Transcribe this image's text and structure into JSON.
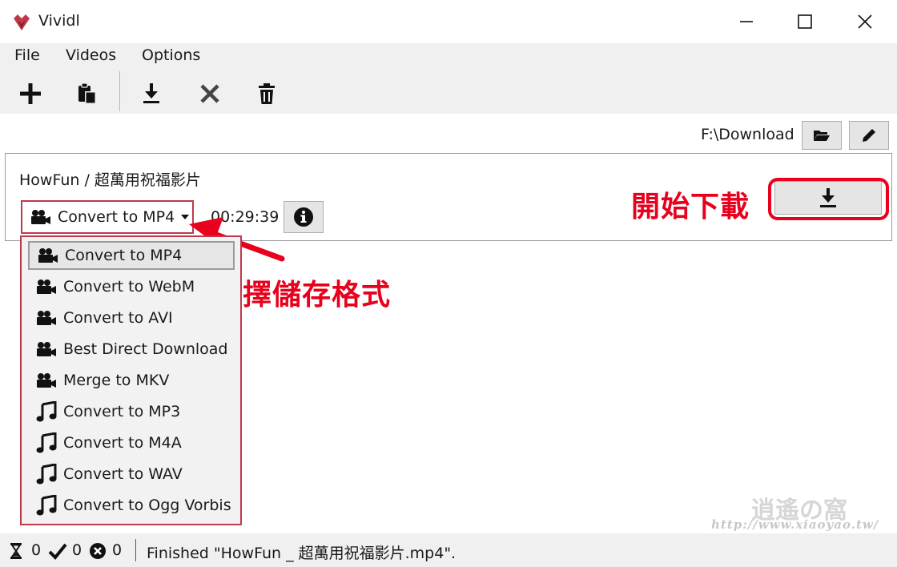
{
  "window": {
    "title": "Vividl",
    "icons": {
      "logo": "vividl-logo-icon",
      "minimize": "minimize-icon",
      "maximize": "maximize-icon",
      "close": "close-icon"
    }
  },
  "menu": [
    "File",
    "Videos",
    "Options"
  ],
  "toolbar": {
    "buttons": [
      {
        "name": "add-icon"
      },
      {
        "name": "paste-icon"
      },
      {
        "name": "download-icon"
      },
      {
        "name": "cancel-icon"
      },
      {
        "name": "delete-icon"
      }
    ]
  },
  "download_path": {
    "value": "F:\\Download",
    "open_icon": "folder-open-icon",
    "edit_icon": "pencil-icon"
  },
  "video": {
    "title": "HowFun / 超萬用祝福影片",
    "format": "Convert to MP4",
    "duration": "00:29:39",
    "info_icon": "info-icon",
    "download_icon": "download-icon"
  },
  "format_options": [
    {
      "label": "Convert to MP4",
      "icon": "video-camera-icon",
      "selected": true
    },
    {
      "label": "Convert to WebM",
      "icon": "video-camera-icon"
    },
    {
      "label": "Convert to AVI",
      "icon": "video-camera-icon"
    },
    {
      "label": "Best Direct Download",
      "icon": "video-camera-icon"
    },
    {
      "label": "Merge to MKV",
      "icon": "video-camera-icon"
    },
    {
      "label": "Convert to MP3",
      "icon": "music-note-icon"
    },
    {
      "label": "Convert to M4A",
      "icon": "music-note-icon"
    },
    {
      "label": "Convert to WAV",
      "icon": "music-note-icon"
    },
    {
      "label": "Convert to Ogg Vorbis",
      "icon": "music-note-icon"
    }
  ],
  "annotations": {
    "start_download": "開始下載",
    "select_format": "選擇儲存格式",
    "color": "#e8001c"
  },
  "watermark": {
    "logo": "逍遙の窩",
    "url": "http://www.xiaoyao.tw/"
  },
  "status": {
    "pending": "0",
    "done": "0",
    "failed": "0",
    "message": "Finished \"HowFun _ 超萬用祝福影片.mp4\"."
  },
  "colors": {
    "accent_border": "#c0394b",
    "toolbar_bg": "#f0f0f0"
  }
}
